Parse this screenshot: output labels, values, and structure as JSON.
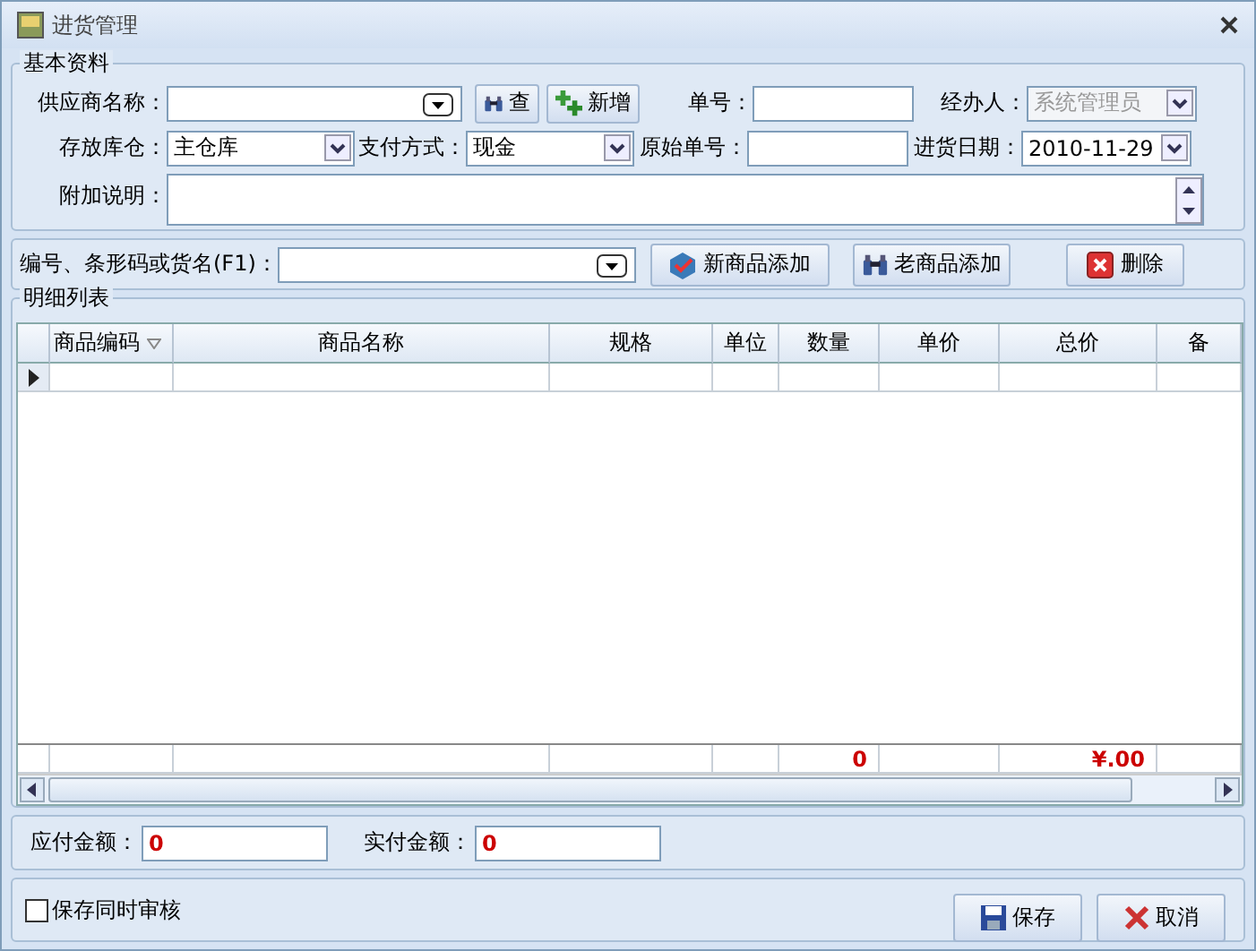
{
  "window": {
    "title": "进货管理"
  },
  "basic_info": {
    "legend": "基本资料",
    "supplier": {
      "label": "供应商名称："
    },
    "find_button": "查",
    "add_button": "新增",
    "order_no": {
      "label": "单号："
    },
    "handler": {
      "label": "经办人：",
      "value": "系统管理员",
      "disabled": true
    },
    "warehouse": {
      "label": "存放库仓：",
      "value": "主仓库"
    },
    "payment": {
      "label": "支付方式：",
      "value": "现金"
    },
    "original_no": {
      "label": "原始单号："
    },
    "date": {
      "label": "进货日期：",
      "value": "2010-11-29"
    },
    "note": {
      "label": "附加说明："
    }
  },
  "item_bar": {
    "search_label": "编号、条形码或货名(F1)：",
    "buttons": [
      {
        "kind": "new",
        "label": "新商品添加"
      },
      {
        "kind": "find",
        "label": "老商品添加"
      },
      {
        "kind": "delete",
        "label": "删除"
      }
    ]
  },
  "detail": {
    "legend": "明细列表",
    "columns": [
      {
        "label": "商品编码",
        "sorted": true
      },
      {
        "label": "商品名称",
        "sorted": false
      },
      {
        "label": "规格",
        "sorted": false
      },
      {
        "label": "单位",
        "sorted": false
      },
      {
        "label": "数量",
        "sorted": false,
        "total": "0"
      },
      {
        "label": "单价",
        "sorted": false
      },
      {
        "label": "总价",
        "sorted": false,
        "total": "¥.00"
      },
      {
        "label": "备",
        "sorted": false
      }
    ],
    "new_row": {
      "current": true
    }
  },
  "summary": {
    "payable": {
      "label": "应付金额：",
      "value": "0"
    },
    "paid": {
      "label": "实付金额：",
      "value": "0"
    }
  },
  "footer": {
    "audit": {
      "label": "保存同时审核",
      "checked": false
    },
    "buttons": [
      {
        "kind": "save",
        "label": "保存"
      },
      {
        "kind": "cancel",
        "label": "取消"
      }
    ]
  }
}
